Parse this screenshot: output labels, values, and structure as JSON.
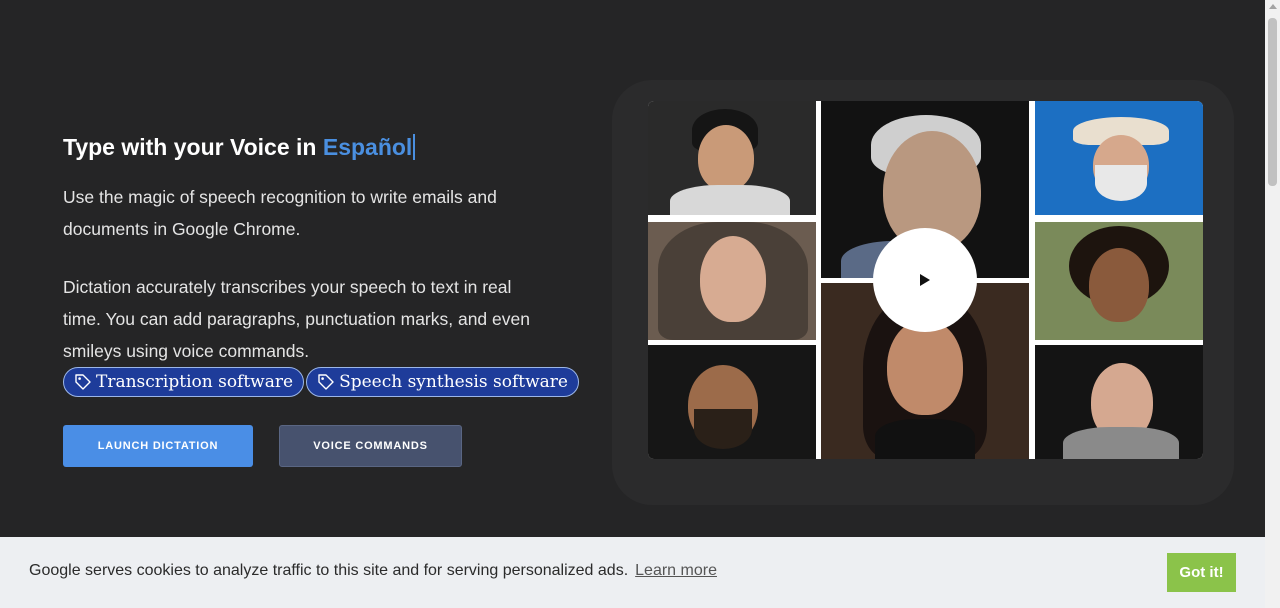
{
  "hero": {
    "title_prefix": "Type with your Voice in ",
    "title_language": "Español",
    "paragraph1": "Use the magic of speech recognition to write emails and documents in Google Chrome.",
    "paragraph2": "Dictation accurately transcribes your speech to text in real time. You can add paragraphs, punctuation marks, and even smileys using voice commands.",
    "tags": [
      "Transcription software",
      "Speech synthesis software"
    ],
    "buttons": {
      "launch": "LAUNCH DICTATION",
      "commands": "VOICE COMMANDS"
    }
  },
  "media": {
    "play_icon": "play-icon"
  },
  "cookie": {
    "message": "Google serves cookies to analyze traffic to this site and for serving personalized ads.",
    "learn_more": "Learn more",
    "accept": "Got it!"
  },
  "colors": {
    "background": "#252526",
    "accent": "#4a8fe0",
    "tag_bg": "#1e3c9a",
    "primary_button": "#4a8ee6",
    "secondary_button": "#47526e",
    "cookie_button": "#8bc34a"
  }
}
